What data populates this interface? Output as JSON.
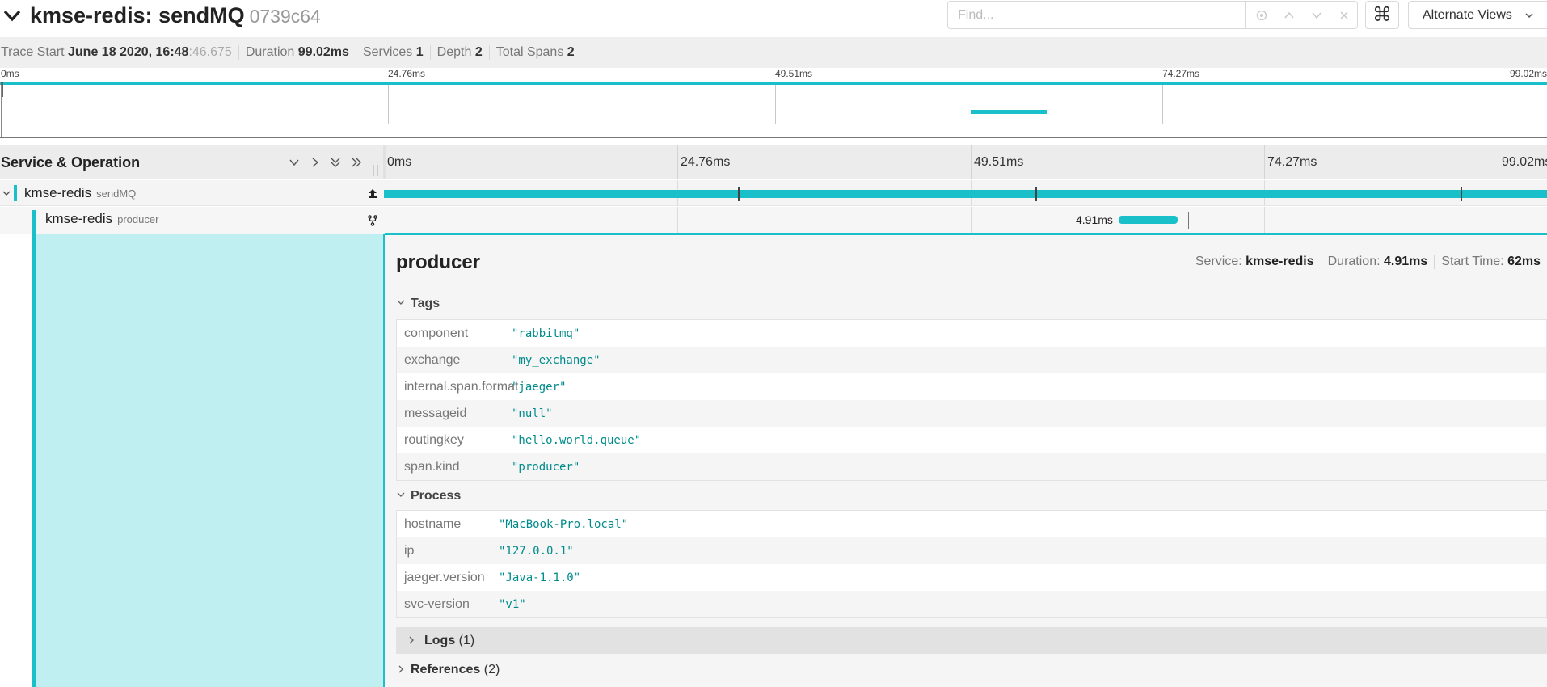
{
  "header": {
    "title": "kmse-redis: sendMQ",
    "trace_id": "0739c64",
    "find_placeholder": "Find...",
    "kbd_glyph": "⌘",
    "alternate_views_label": "Alternate Views"
  },
  "summary": {
    "trace_start_label": "Trace Start",
    "trace_start_value": "June 18 2020, 16:48",
    "trace_start_ms": ":46.675",
    "duration_label": "Duration",
    "duration_value": "99.02ms",
    "services_label": "Services",
    "services_value": "1",
    "depth_label": "Depth",
    "depth_value": "2",
    "total_spans_label": "Total Spans",
    "total_spans_value": "2"
  },
  "minimap": {
    "ticks": [
      "0ms",
      "24.76ms",
      "49.51ms",
      "74.27ms",
      "99.02ms"
    ]
  },
  "timeline": {
    "column_title": "Service & Operation",
    "ticks": [
      "0ms",
      "24.76ms",
      "49.51ms",
      "74.27ms",
      "99.02ms"
    ]
  },
  "spans": [
    {
      "service": "kmse-redis",
      "operation": "sendMQ"
    },
    {
      "service": "kmse-redis",
      "operation": "producer",
      "duration": "4.91ms"
    }
  ],
  "detail": {
    "title": "producer",
    "service_label": "Service:",
    "service_value": "kmse-redis",
    "duration_label": "Duration:",
    "duration_value": "4.91ms",
    "start_label": "Start Time:",
    "start_value": "62ms",
    "tags_label": "Tags",
    "tags": [
      {
        "key": "component",
        "value": "\"rabbitmq\""
      },
      {
        "key": "exchange",
        "value": "\"my_exchange\""
      },
      {
        "key": "internal.span.format",
        "value": "\"jaeger\""
      },
      {
        "key": "messageid",
        "value": "\"null\""
      },
      {
        "key": "routingkey",
        "value": "\"hello.world.queue\""
      },
      {
        "key": "span.kind",
        "value": "\"producer\""
      }
    ],
    "process_label": "Process",
    "process": [
      {
        "key": "hostname",
        "value": "\"MacBook-Pro.local\""
      },
      {
        "key": "ip",
        "value": "\"127.0.0.1\""
      },
      {
        "key": "jaeger.version",
        "value": "\"Java-1.1.0\""
      },
      {
        "key": "svc-version",
        "value": "\"v1\""
      }
    ],
    "logs_label": "Logs",
    "logs_count": "(1)",
    "references_label": "References",
    "references_count": "(2)"
  },
  "colors": {
    "accent": "#19c0c9",
    "span_highlight": "#c0eff2",
    "tag_value": "#008b8b"
  }
}
